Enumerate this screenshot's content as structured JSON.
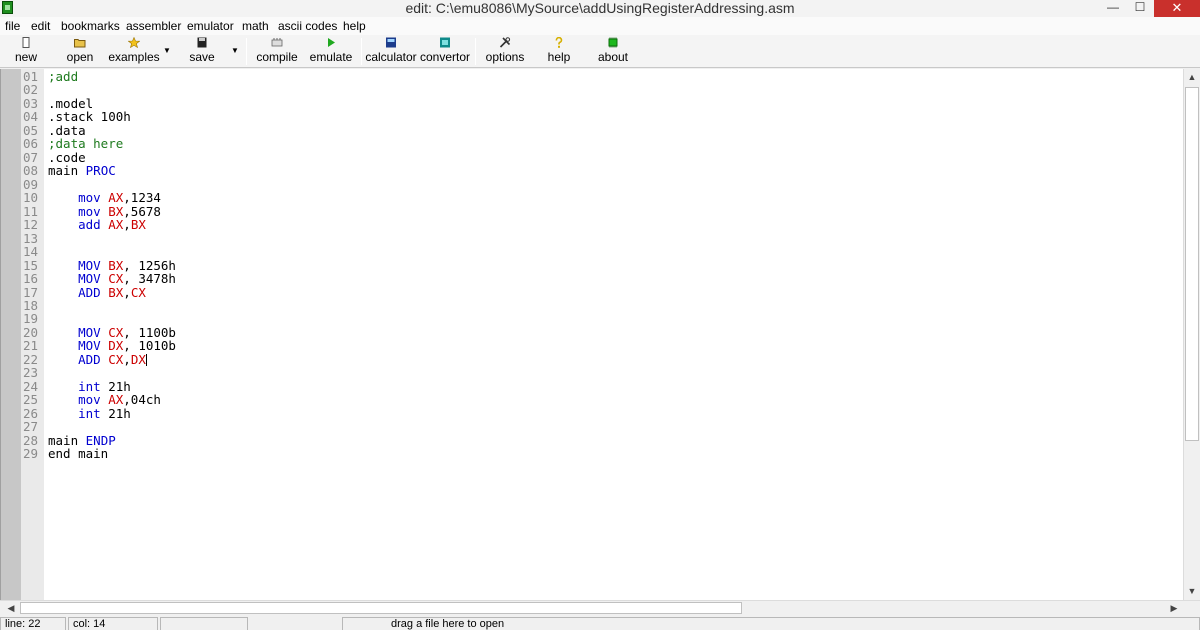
{
  "window": {
    "title": "edit: C:\\emu8086\\MySource\\addUsingRegisterAddressing.asm",
    "minimize_glyph": "—",
    "maximize_glyph": "☐",
    "close_glyph": "✕"
  },
  "menu": [
    "file",
    "edit",
    "bookmarks",
    "assembler",
    "emulator",
    "math",
    "ascii codes",
    "help"
  ],
  "toolbar": {
    "new": "new",
    "open": "open",
    "examples": "examples",
    "save": "save",
    "compile": "compile",
    "emulate": "emulate",
    "calculator": "calculator",
    "convertor": "convertor",
    "options": "options",
    "help": "help",
    "about": "about"
  },
  "icons": {
    "new": "new-file-icon",
    "open": "open-folder-icon",
    "examples": "star-icon",
    "save": "floppy-disk-icon",
    "compile": "compile-icon",
    "emulate": "play-icon",
    "calculator": "calculator-icon",
    "convertor": "convertor-icon",
    "options": "tools-icon",
    "help": "question-icon",
    "about": "chip-icon"
  },
  "editor": {
    "lines": [
      {
        "n": "01",
        "tokens": [
          {
            "t": ";add",
            "c": "comment"
          }
        ]
      },
      {
        "n": "02",
        "tokens": []
      },
      {
        "n": "03",
        "tokens": [
          {
            "t": ".model",
            "c": ""
          }
        ]
      },
      {
        "n": "04",
        "tokens": [
          {
            "t": ".stack 100h",
            "c": ""
          }
        ]
      },
      {
        "n": "05",
        "tokens": [
          {
            "t": ".data",
            "c": ""
          }
        ]
      },
      {
        "n": "06",
        "tokens": [
          {
            "t": ";data here",
            "c": "comment"
          }
        ]
      },
      {
        "n": "07",
        "tokens": [
          {
            "t": ".code",
            "c": ""
          }
        ]
      },
      {
        "n": "08",
        "tokens": [
          {
            "t": "main ",
            "c": ""
          },
          {
            "t": "PROC",
            "c": "kw"
          }
        ]
      },
      {
        "n": "09",
        "tokens": []
      },
      {
        "n": "10",
        "tokens": [
          {
            "t": "    ",
            "c": ""
          },
          {
            "t": "mov",
            "c": "kw"
          },
          {
            "t": " ",
            "c": ""
          },
          {
            "t": "AX",
            "c": "reg"
          },
          {
            "t": ",1234",
            "c": ""
          }
        ]
      },
      {
        "n": "11",
        "tokens": [
          {
            "t": "    ",
            "c": ""
          },
          {
            "t": "mov",
            "c": "kw"
          },
          {
            "t": " ",
            "c": ""
          },
          {
            "t": "BX",
            "c": "reg"
          },
          {
            "t": ",5678",
            "c": ""
          }
        ]
      },
      {
        "n": "12",
        "tokens": [
          {
            "t": "    ",
            "c": ""
          },
          {
            "t": "add",
            "c": "kw"
          },
          {
            "t": " ",
            "c": ""
          },
          {
            "t": "AX",
            "c": "reg"
          },
          {
            "t": ",",
            "c": ""
          },
          {
            "t": "BX",
            "c": "reg"
          }
        ]
      },
      {
        "n": "13",
        "tokens": []
      },
      {
        "n": "14",
        "tokens": []
      },
      {
        "n": "15",
        "tokens": [
          {
            "t": "    ",
            "c": ""
          },
          {
            "t": "MOV",
            "c": "kw"
          },
          {
            "t": " ",
            "c": ""
          },
          {
            "t": "BX",
            "c": "reg"
          },
          {
            "t": ", 1256h",
            "c": ""
          }
        ]
      },
      {
        "n": "16",
        "tokens": [
          {
            "t": "    ",
            "c": ""
          },
          {
            "t": "MOV",
            "c": "kw"
          },
          {
            "t": " ",
            "c": ""
          },
          {
            "t": "CX",
            "c": "reg"
          },
          {
            "t": ", 3478h",
            "c": ""
          }
        ]
      },
      {
        "n": "17",
        "tokens": [
          {
            "t": "    ",
            "c": ""
          },
          {
            "t": "ADD",
            "c": "kw"
          },
          {
            "t": " ",
            "c": ""
          },
          {
            "t": "BX",
            "c": "reg"
          },
          {
            "t": ",",
            "c": ""
          },
          {
            "t": "CX",
            "c": "reg"
          }
        ]
      },
      {
        "n": "18",
        "tokens": []
      },
      {
        "n": "19",
        "tokens": []
      },
      {
        "n": "20",
        "tokens": [
          {
            "t": "    ",
            "c": ""
          },
          {
            "t": "MOV",
            "c": "kw"
          },
          {
            "t": " ",
            "c": ""
          },
          {
            "t": "CX",
            "c": "reg"
          },
          {
            "t": ", 1100b",
            "c": ""
          }
        ]
      },
      {
        "n": "21",
        "tokens": [
          {
            "t": "    ",
            "c": ""
          },
          {
            "t": "MOV",
            "c": "kw"
          },
          {
            "t": " ",
            "c": ""
          },
          {
            "t": "DX",
            "c": "reg"
          },
          {
            "t": ", 1010b",
            "c": ""
          }
        ]
      },
      {
        "n": "22",
        "tokens": [
          {
            "t": "    ",
            "c": ""
          },
          {
            "t": "ADD",
            "c": "kw"
          },
          {
            "t": " ",
            "c": ""
          },
          {
            "t": "CX",
            "c": "reg"
          },
          {
            "t": ",",
            "c": ""
          },
          {
            "t": "DX",
            "c": "reg"
          }
        ],
        "caret": true
      },
      {
        "n": "23",
        "tokens": []
      },
      {
        "n": "24",
        "tokens": [
          {
            "t": "    ",
            "c": ""
          },
          {
            "t": "int",
            "c": "kw"
          },
          {
            "t": " 21h",
            "c": ""
          }
        ]
      },
      {
        "n": "25",
        "tokens": [
          {
            "t": "    ",
            "c": ""
          },
          {
            "t": "mov",
            "c": "kw"
          },
          {
            "t": " ",
            "c": ""
          },
          {
            "t": "AX",
            "c": "reg"
          },
          {
            "t": ",04ch",
            "c": ""
          }
        ]
      },
      {
        "n": "26",
        "tokens": [
          {
            "t": "    ",
            "c": ""
          },
          {
            "t": "int",
            "c": "kw"
          },
          {
            "t": " 21h",
            "c": ""
          }
        ]
      },
      {
        "n": "27",
        "tokens": []
      },
      {
        "n": "28",
        "tokens": [
          {
            "t": "main ",
            "c": ""
          },
          {
            "t": "ENDP",
            "c": "kw"
          }
        ]
      },
      {
        "n": "29",
        "tokens": [
          {
            "t": "end main",
            "c": ""
          }
        ]
      }
    ]
  },
  "status": {
    "line": "line: 22",
    "col": "col: 14",
    "hint": "drag a file here to open"
  },
  "colors": {
    "comment": "#1e7a1e",
    "keyword": "#0000d0",
    "register": "#cc0000"
  }
}
